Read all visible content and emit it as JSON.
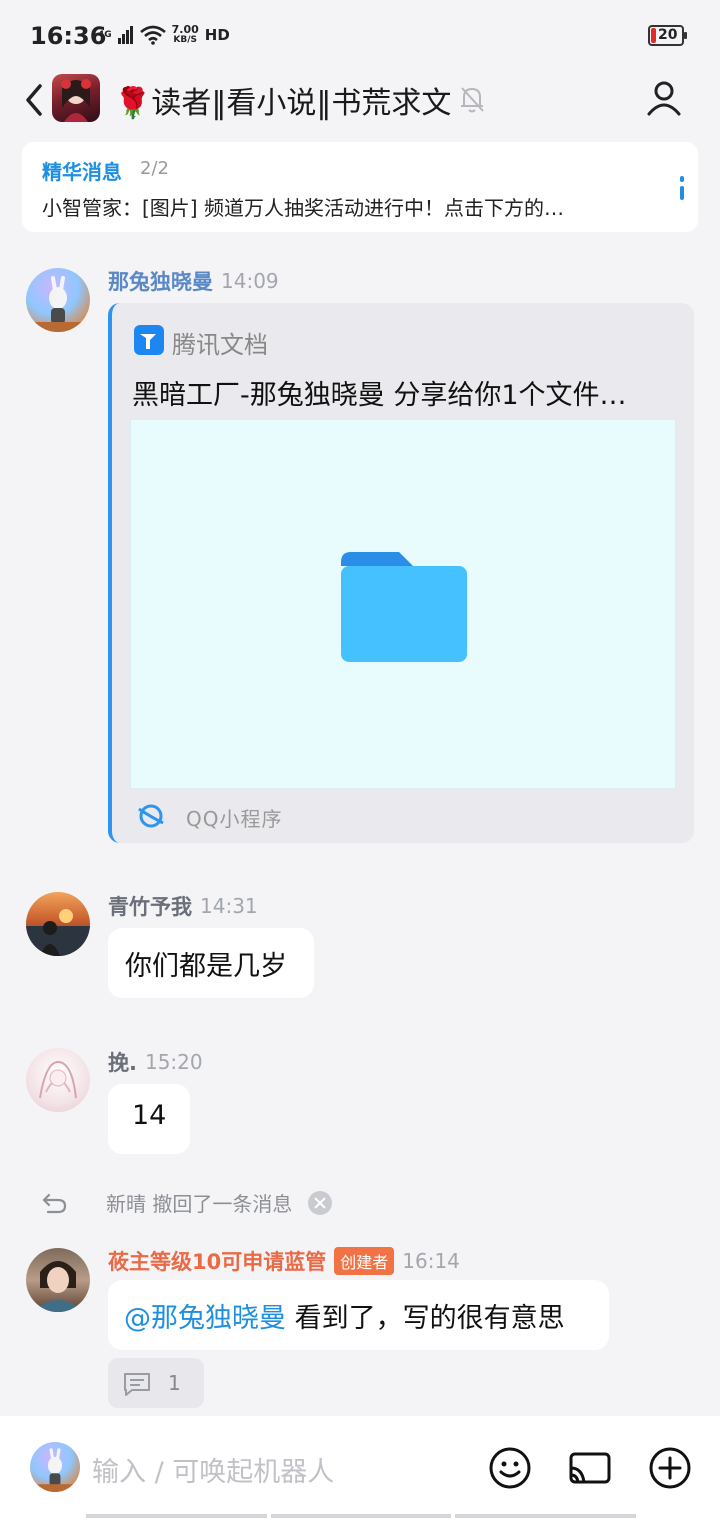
{
  "status_bar": {
    "time": "16:36",
    "network": "4G",
    "speed_top": "7.00",
    "speed_bottom": "KB/S",
    "hd": "HD",
    "battery": "20"
  },
  "header": {
    "title": "🌹读者‖看小说‖书荒求文"
  },
  "pinned": {
    "label": "精华消息",
    "count": "2/2",
    "text": "小智管家：[图片] 频道万人抽奖活动进行中！点击下方的…"
  },
  "messages": [
    {
      "sender": "那兔独晓曼",
      "time": "14:09",
      "card": {
        "app_name": "腾讯文档",
        "title": "黑暗工厂-那兔独晓曼 分享给你1个文件…",
        "footer": "QQ小程序"
      }
    },
    {
      "sender": "青竹予我",
      "time": "14:31",
      "text": "你们都是几岁"
    },
    {
      "sender": "挽.",
      "time": "15:20",
      "text": "14"
    },
    {
      "sender": "莜主等级10可申请蓝管",
      "badge": "创建者",
      "time": "16:14",
      "mention": "@那兔独晓曼",
      "text": " 看到了，写的很有意思",
      "reply_count": "1"
    }
  ],
  "recall_notice": "新晴 撤回了一条消息",
  "input": {
    "placeholder": "输入 / 可唤起机器人"
  },
  "colors": {
    "accent": "#1e8fe1",
    "creator_badge": "#f07245",
    "background": "#f4f4f6"
  }
}
